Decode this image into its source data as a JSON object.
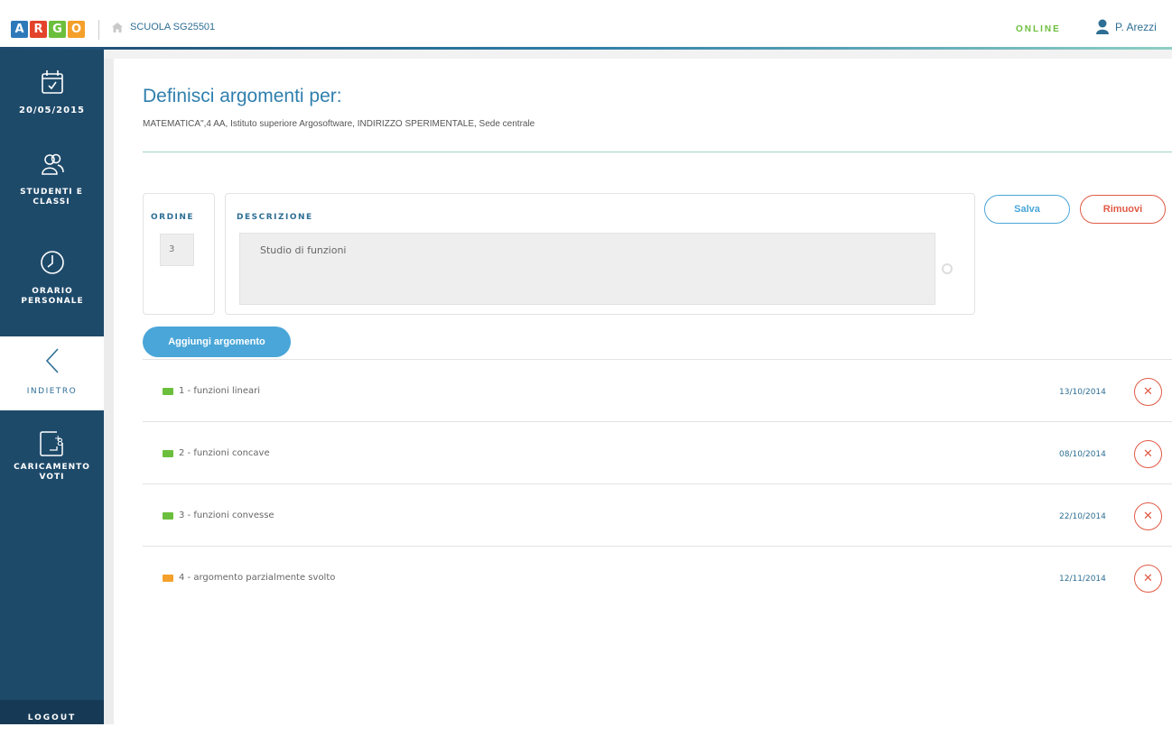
{
  "header": {
    "logo_letters": [
      {
        "char": "A",
        "color": "#2e79b9"
      },
      {
        "char": "R",
        "color": "#e4432b"
      },
      {
        "char": "G",
        "color": "#6cbf3d"
      },
      {
        "char": "O",
        "color": "#f4a02a"
      }
    ],
    "school": "SCUOLA SG25501",
    "status": "ONLINE",
    "user": "P. Arezzi"
  },
  "sidebar": {
    "date": "20/05/2015",
    "students": "STUDENTI E CLASSI",
    "schedule": "ORARIO PERSONALE",
    "back": "INDIETRO",
    "grades": "CARICAMENTO VOTI",
    "logout": "LOGOUT"
  },
  "main": {
    "title": "Definisci argomenti per:",
    "subtitle": "MATEMATICA\",4 AA, Istituto superiore Argosoftware, INDIRIZZO SPERIMENTALE, Sede centrale",
    "ordine_label": "ORDINE",
    "ordine_value": "3",
    "descrizione_label": "DESCRIZIONE",
    "descrizione_value": "Studio di funzioni",
    "save_label": "Salva",
    "remove_label": "Rimuovi",
    "add_label": "Aggiungi argomento"
  },
  "topics": [
    {
      "label": "1 - funzioni lineari",
      "date": "13/10/2014",
      "status_color": "#6cbf3d"
    },
    {
      "label": "2 - funzioni concave",
      "date": "08/10/2014",
      "status_color": "#6cbf3d"
    },
    {
      "label": "3 - funzioni convesse",
      "date": "22/10/2014",
      "status_color": "#6cbf3d"
    },
    {
      "label": "4 - argomento parzialmente svolto",
      "date": "12/11/2014",
      "status_color": "#f4a02a"
    }
  ],
  "colors": {
    "accent": "#4aa6d8",
    "danger": "#e05a45",
    "sidebar": "#1e4a6a"
  }
}
